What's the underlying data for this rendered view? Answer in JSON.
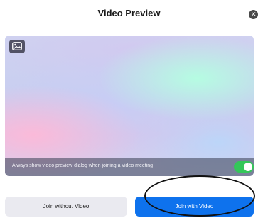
{
  "dialog": {
    "title": "Video Preview",
    "close_icon": "close-icon"
  },
  "preview": {
    "background_button_icon": "virtual-background-icon",
    "option_text": "Always show video preview dialog when joining a video meeting",
    "option_enabled": true
  },
  "buttons": {
    "join_without_video": "Join without Video",
    "join_with_video": "Join with Video"
  },
  "colors": {
    "accent": "#0e72ed",
    "toggle_on": "#34c759",
    "secondary_button": "#eaeaf0"
  }
}
